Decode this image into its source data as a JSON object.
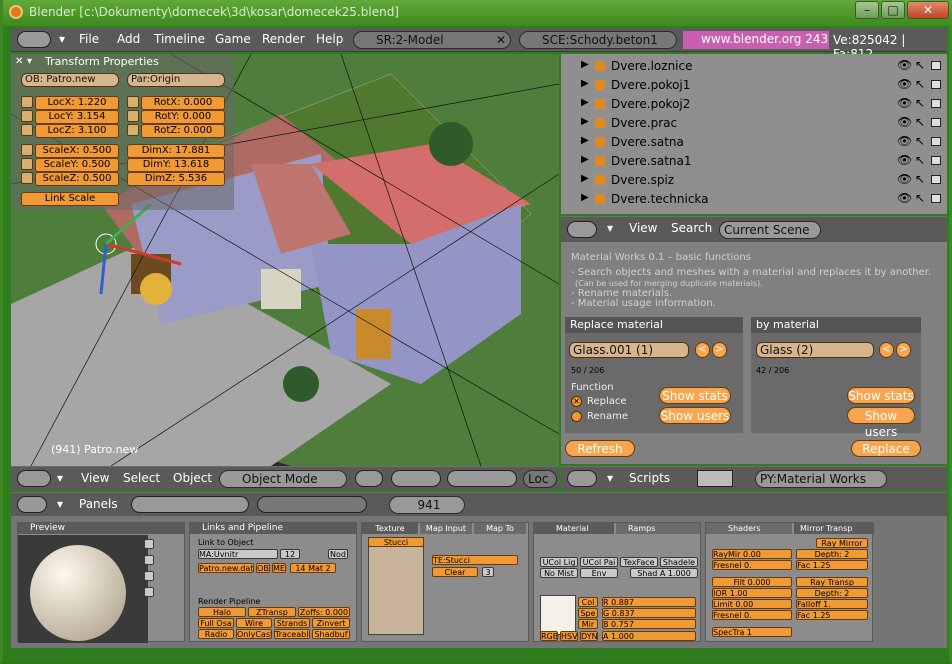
{
  "window": {
    "title": "Blender [c:\\Dokumenty\\domecek\\3d\\kosar\\domecek25.blend]"
  },
  "menubar": {
    "items": [
      "File",
      "Add",
      "Timeline",
      "Game",
      "Render",
      "Help"
    ],
    "screen": "SR:2-Model",
    "scene": "SCE:Schody.beton1",
    "url": "www.blender.org 243",
    "stats": "Ve:825042 | Fa:812"
  },
  "transform": {
    "title": "Transform Properties",
    "ob": "OB: Patro.new",
    "par": "Par:Origin",
    "loc": [
      "LocX: 1.220",
      "LocY: 3.154",
      "LocZ: 3.100"
    ],
    "rot": [
      "RotX: 0.000",
      "RotY: 0.000",
      "RotZ: 0.000"
    ],
    "scale": [
      "ScaleX: 0.500",
      "ScaleY: 0.500",
      "ScaleZ: 0.500"
    ],
    "dim": [
      "DimX: 17.881",
      "DimY: 13.618",
      "DimZ: 5.536"
    ],
    "link_scale": "Link Scale"
  },
  "viewport": {
    "object_label": "(941) Patro.new"
  },
  "view_header": {
    "items": [
      "View",
      "Select",
      "Object"
    ],
    "mode": "Object Mode",
    "loc": "Loc"
  },
  "outliner": {
    "rows": [
      "Dvere.loznice",
      "Dvere.pokoj1",
      "Dvere.pokoj2",
      "Dvere.prac",
      "Dvere.satna",
      "Dvere.satna1",
      "Dvere.spiz",
      "Dvere.technicka"
    ],
    "header": {
      "view": "View",
      "search": "Search",
      "scope": "Current Scene"
    }
  },
  "script": {
    "heading": "Material Works 0.1 – basic functions",
    "lines": [
      "- Search objects and meshes with a material and replaces it by another.",
      "(Can be used for merging duplicate materials).",
      "- Rename materials.",
      "- Material usage information."
    ],
    "replace_label": "Replace material",
    "by_label": "by material",
    "replace_value": "Glass.001 (1)",
    "by_value": "Glass (2)",
    "replace_count": "50 / 206",
    "by_count": "42 / 206",
    "function_label": "Function",
    "opt_replace": "Replace",
    "opt_rename": "Rename",
    "show_stats": "Show stats",
    "show_users": "Show users",
    "refresh": "Refresh",
    "replace_btn": "Replace",
    "header_scripts": "Scripts",
    "header_py": "PY:Material Works"
  },
  "buttons_header": {
    "panels": "Panels",
    "frame": "941"
  },
  "panels": {
    "preview": "Preview",
    "links": "Links and Pipeline",
    "link_to_object": "Link to Object",
    "ma": "MA:Uvnitr",
    "ma_users": "12",
    "nod": "Nod",
    "patro": "Patro.new.data",
    "ob_btn": "OB",
    "me_btn": "ME",
    "mat": "14 Mat 2",
    "render_pipeline": "Render Pipeline",
    "rp": [
      "Halo",
      "ZTransp",
      "Zoffs: 0.000",
      "Full Osa",
      "Wire",
      "Strands",
      "Zinvert",
      "Radio",
      "OnlyCast",
      "Traceable",
      "Shadbuf"
    ],
    "texture": "Texture",
    "map_input": "Map Input",
    "map_to": "Map To",
    "stucci": "Stucci",
    "te": "TE:Stucci",
    "clear": "Clear",
    "tex_users": "3",
    "material": "Material",
    "ramps": "Ramps",
    "mat_btns": [
      "UCol Lig",
      "UCol Pai",
      "TexFace",
      "Shadele",
      "No Mist",
      "Env",
      "Shad A 1.000"
    ],
    "col": "Col",
    "spe": "Spe",
    "mir": "Mir",
    "r": "R 0.887",
    "g": "G 0.837",
    "b": "B 0.757",
    "rgb": "RGB",
    "hsv": "HSV",
    "dyn": "DYN",
    "alpha": "A 1.000",
    "shaders": "Shaders",
    "mirror": "Mirror Transp",
    "ray_mirror": "Ray Mirror",
    "raymir": "RayMir 0.00",
    "depth2a": "Depth: 2",
    "fresnel0": "Fresnel 0.",
    "fac125": "Fac 1.25",
    "filt": "Filt 0.000",
    "ray_transp": "Ray Transp",
    "ior": "IOR 1.00",
    "depth2b": "Depth: 2",
    "limit": "Limit 0.00",
    "falloff": "Falloff 1.",
    "fresnel0b": "Fresnel 0.",
    "fac125b": "Fac 1.25",
    "spectra": "SpecTra 1"
  },
  "colors": {
    "accent": "#f09a36",
    "panel": "#8c8c8c",
    "header": "#5a5a5a"
  }
}
